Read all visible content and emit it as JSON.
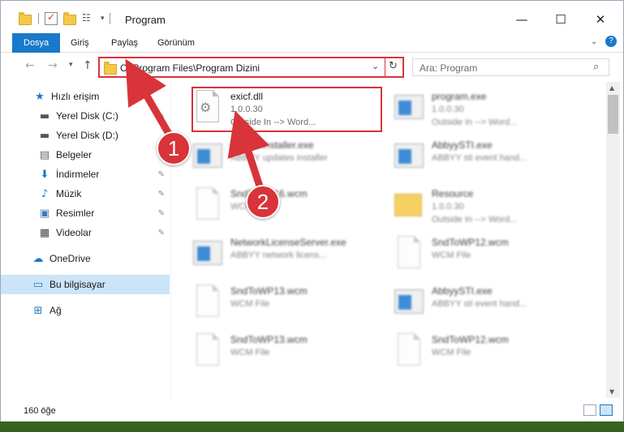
{
  "window": {
    "title": "Program",
    "controls": {
      "minimize": "—",
      "maximize": "☐",
      "close": "✕"
    }
  },
  "ribbon": {
    "tabs": [
      "Dosya",
      "Giriş",
      "Paylaş",
      "Görünüm"
    ]
  },
  "nav": {
    "address": "C:\\Program Files\\Program Dizini",
    "search_placeholder": "Ara: Program"
  },
  "sidebar": {
    "items": [
      {
        "label": "Hızlı erişim",
        "icon": "star-icon"
      },
      {
        "label": "Yerel Disk (C:)",
        "icon": "drive-icon"
      },
      {
        "label": "Yerel Disk (D:)",
        "icon": "drive-icon"
      },
      {
        "label": "Belgeler",
        "icon": "documents-icon"
      },
      {
        "label": "İndirmeler",
        "icon": "download-icon"
      },
      {
        "label": "Müzik",
        "icon": "music-icon"
      },
      {
        "label": "Resimler",
        "icon": "pictures-icon"
      },
      {
        "label": "Videolar",
        "icon": "video-icon"
      },
      {
        "label": "OneDrive",
        "icon": "cloud-icon"
      },
      {
        "label": "Bu bilgisayar",
        "icon": "computer-icon"
      },
      {
        "label": "Ağ",
        "icon": "network-icon"
      }
    ]
  },
  "files": [
    {
      "name": "exicf.dll",
      "line1": "1.0.0.30",
      "line2": "Outside In --> Word...",
      "type": "dll"
    },
    {
      "name": "program.exe",
      "line1": "1.0.0.30",
      "line2": "Outside In --> Word...",
      "type": "exe"
    },
    {
      "name": "UpdateInstaller.exe",
      "line1": "ABBYY updates installer",
      "line2": "",
      "type": "exe"
    },
    {
      "name": "AbbyySTI.exe",
      "line1": "ABBYY sti event hand...",
      "line2": "",
      "type": "exe"
    },
    {
      "name": "SndToWP16.wcm",
      "line1": "WCM File",
      "line2": "",
      "type": "doc"
    },
    {
      "name": "Resource",
      "line1": "1.0.0.30",
      "line2": "Outside In --> Word...",
      "type": "folder"
    },
    {
      "name": "NetworkLicenseServer.exe",
      "line1": "ABBYY network licens...",
      "line2": "",
      "type": "exe"
    },
    {
      "name": "SndToWP12.wcm",
      "line1": "WCM File",
      "line2": "",
      "type": "doc"
    },
    {
      "name": "SndToWP13.wcm",
      "line1": "WCM File",
      "line2": "",
      "type": "doc"
    },
    {
      "name": "AbbyySTI.exe",
      "line1": "ABBYY sti event hand...",
      "line2": "",
      "type": "exe"
    },
    {
      "name": "SndToWP13.wcm",
      "line1": "WCM File",
      "line2": "",
      "type": "doc"
    },
    {
      "name": "SndToWP12.wcm",
      "line1": "WCM File",
      "line2": "",
      "type": "doc"
    }
  ],
  "status": {
    "count": "160 öğe"
  },
  "annotations": {
    "step1": "1",
    "step2": "2",
    "color": "#d8343a"
  }
}
